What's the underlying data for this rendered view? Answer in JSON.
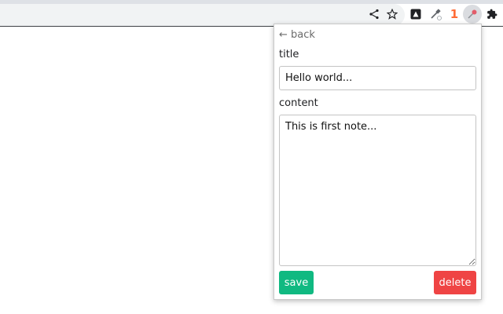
{
  "browser": {
    "toolbar_icons": [
      "share-icon",
      "star-icon",
      "extension-icon-dark",
      "eyedropper-icon",
      "extension-badge-one",
      "pin-extension-icon",
      "puzzle-icon"
    ],
    "badge_text": "1"
  },
  "popup": {
    "back_label": "← back",
    "title_label": "title",
    "title_value": "Hello world...",
    "content_label": "content",
    "content_value": "This is first note...",
    "save_label": "save",
    "delete_label": "delete"
  },
  "colors": {
    "save": "#10b981",
    "delete": "#ef4444",
    "badge": "#ff6c37"
  }
}
